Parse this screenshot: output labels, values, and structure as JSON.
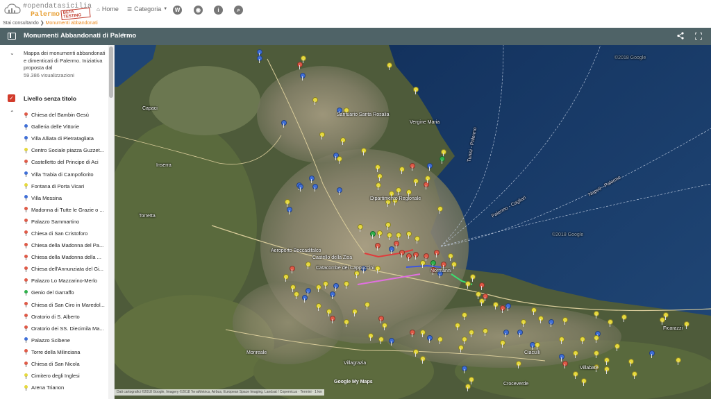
{
  "nav": {
    "logo_top": "#opendatasicilia",
    "logo_bottom": "Palermo Hub",
    "logo_badge": "BETA TESTING",
    "home_label": "Home",
    "category_label": "Categoria",
    "icons": [
      "wordpress-icon",
      "github-icon",
      "info-icon",
      "search-icon"
    ],
    "icon_glyphs": [
      "W",
      "◉",
      "i",
      "⌕"
    ]
  },
  "breadcrumb": {
    "prefix": "Stai consultando",
    "current": "Monumenti abbandonati"
  },
  "titlebar": {
    "title": "Monumenti Abbandonati di Palermo",
    "share_icon": "share-icon",
    "fullscreen_icon": "fullscreen-icon"
  },
  "sidebar": {
    "description": "Mappa dei monumenti abbandonati e dimenticati di Palermo. Iniziativa proposta dal",
    "views": "59.386 visualizzazioni",
    "layer_title": "Livello senza titolo",
    "items": [
      {
        "label": "Chiesa del Bambin Gesù",
        "color": "#e05a47"
      },
      {
        "label": "Galleria delle Vittorie",
        "color": "#3f6fd8"
      },
      {
        "label": "Villa Alliata di Pietratagliata",
        "color": "#3f6fd8"
      },
      {
        "label": "Centro Sociale piazza Guzzet...",
        "color": "#e6d93c"
      },
      {
        "label": "Castelletto del Principe di Aci",
        "color": "#e05a47"
      },
      {
        "label": "Villa Trabia di Campofiorito",
        "color": "#3f6fd8"
      },
      {
        "label": "Fontana di Porta Vicari",
        "color": "#e6d93c"
      },
      {
        "label": "Villa Messina",
        "color": "#3f6fd8"
      },
      {
        "label": "Madonna di Tutte le Grazie o ...",
        "color": "#e05a47"
      },
      {
        "label": "Palazzo Sammartino",
        "color": "#e05a47"
      },
      {
        "label": "Chiesa di San Cristoforo",
        "color": "#e05a47"
      },
      {
        "label": "Chiesa della Madonna del Pa...",
        "color": "#e05a47"
      },
      {
        "label": "Chiesa della Madonna della ...",
        "color": "#e05a47"
      },
      {
        "label": "Chiesa dell'Annunziata del Gi...",
        "color": "#e05a47"
      },
      {
        "label": "Palazzo Lo Mazzarino-Merlo",
        "color": "#e05a47"
      },
      {
        "label": "Genio del Garraffo",
        "color": "#2fb14b"
      },
      {
        "label": "Chiesa di San Ciro in Maredol...",
        "color": "#e05a47"
      },
      {
        "label": "Oratorio di S. Alberto",
        "color": "#e05a47"
      },
      {
        "label": "Oratorio dei SS. Diecimila Ma...",
        "color": "#e05a47"
      },
      {
        "label": "Palazzo Scibene",
        "color": "#3f6fd8"
      },
      {
        "label": "Torre della Milinciana",
        "color": "#e05a47"
      },
      {
        "label": "Chiesa di San Nicola",
        "color": "#e05a47"
      },
      {
        "label": "Cimitero degli Inglesi",
        "color": "#e6d93c"
      },
      {
        "label": "Arena Trianon",
        "color": "#e6d93c"
      }
    ]
  },
  "map": {
    "labels": [
      "Santuario Santa Rosalia",
      "Dipartimento Regionale",
      "Castello della Zisa",
      "Catacombe dei Cappuccini",
      "Aeroporto Boccadifalco",
      "Normanni",
      "Monreale",
      "Villagrazia",
      "Ciaculli",
      "Croceverde",
      "Villabate",
      "Ficarazzi",
      "Inserra",
      "Torretta",
      "Capaci",
      "Vergine Maria",
      "Napoli - Palermo",
      "Tunisi - Palermo",
      "Palermo - Cagliari"
    ],
    "attribution": "Dati cartografici ©2018 Google, Imagery ©2018 TerraMetrics, Airbus, European Space Imaging, Landsat / Copernicus · Termini · 1 km",
    "brand": "Google My Maps",
    "water_text": "©2018 Google"
  },
  "colors": {
    "titlebar": "#4f6367",
    "accent": "#e8891e",
    "checkbox": "#d23b2b"
  }
}
